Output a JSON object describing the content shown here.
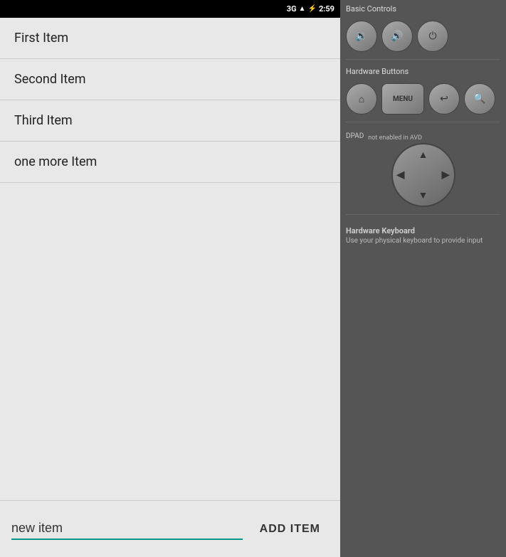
{
  "statusBar": {
    "network": "3G",
    "time": "2:59"
  },
  "listItems": [
    {
      "id": 1,
      "text": "First Item"
    },
    {
      "id": 2,
      "text": "Second Item"
    },
    {
      "id": 3,
      "text": "Third Item"
    },
    {
      "id": 4,
      "text": "one more Item"
    }
  ],
  "inputField": {
    "value": "new item",
    "placeholder": "new item"
  },
  "addButton": {
    "label": "ADD ITEM"
  },
  "avdPanel": {
    "basicControlsTitle": "Basic Controls",
    "hardwareButtonsTitle": "Hardware Buttons",
    "dpadLabel": "DPAD",
    "dpadNote": "not enabled in AVD",
    "keyboardTitle": "Hardware Keyboard",
    "keyboardDesc": "Use your physical keyboard to provide input"
  }
}
